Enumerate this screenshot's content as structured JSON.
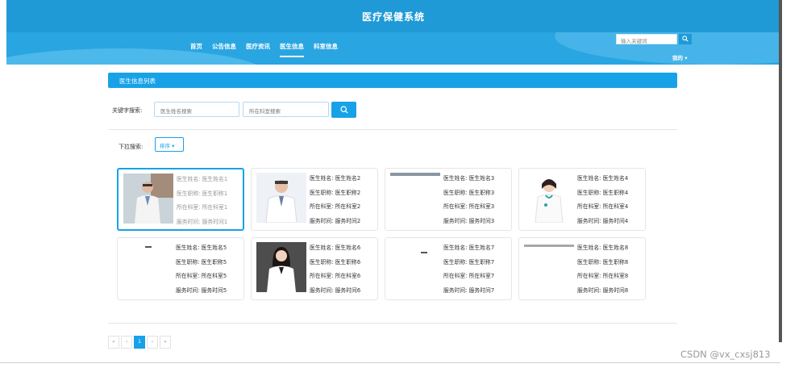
{
  "header": {
    "site_title": "医疗保健系统"
  },
  "nav": {
    "items": [
      {
        "label": "首页"
      },
      {
        "label": "公告信息"
      },
      {
        "label": "医疗资讯"
      },
      {
        "label": "医生信息"
      },
      {
        "label": "科室信息"
      }
    ],
    "active_index": 3,
    "search_placeholder": "输入关键词",
    "user_menu": "我的 ▾"
  },
  "section": {
    "title": "医生信息列表"
  },
  "filters": {
    "keyword_label": "关键字搜索:",
    "name_placeholder": "医生姓名搜索",
    "dept_placeholder": "所在科室搜索",
    "dropdown_label": "下拉搜索:",
    "sort_label": "排序 ▾"
  },
  "doctors": [
    {
      "name": "医生姓名: 医生姓名1",
      "title": "医生职称: 医生职称1",
      "dept": "所在科室: 所在科室1",
      "time": "服务时间: 服务时间1",
      "photo": "doctor-male-glasses"
    },
    {
      "name": "医生姓名: 医生姓名2",
      "title": "医生职称: 医生职称2",
      "dept": "所在科室: 所在科室2",
      "time": "服务时间: 服务时间2",
      "photo": "doctor-male-senior"
    },
    {
      "name": "医生姓名: 医生姓名3",
      "title": "医生职称: 医生职称3",
      "dept": "所在科室: 所在科室3",
      "time": "服务时间: 服务时间3",
      "photo": "photo-cropped"
    },
    {
      "name": "医生姓名: 医生姓名4",
      "title": "医生职称: 医生职称4",
      "dept": "所在科室: 所在科室4",
      "time": "服务时间: 服务时间4",
      "photo": "doctor-female-stethoscope"
    },
    {
      "name": "医生姓名: 医生姓名5",
      "title": "医生职称: 医生职称5",
      "dept": "所在科室: 所在科室5",
      "time": "服务时间: 服务时间5",
      "photo": "photo-cropped"
    },
    {
      "name": "医生姓名: 医生姓名6",
      "title": "医生职称: 医生职称6",
      "dept": "所在科室: 所在科室6",
      "time": "服务时间: 服务时间6",
      "photo": "doctor-female-dark"
    },
    {
      "name": "医生姓名: 医生姓名7",
      "title": "医生职称: 医生职称7",
      "dept": "所在科室: 所在科室7",
      "time": "服务时间: 服务时间7",
      "photo": "photo-cropped"
    },
    {
      "name": "医生姓名: 医生姓名8",
      "title": "医生职称: 医生职称8",
      "dept": "所在科室: 所在科室8",
      "time": "服务时间: 服务时间8",
      "photo": "photo-cropped"
    }
  ],
  "pagination": {
    "first": "«",
    "prev": "‹",
    "current": "1",
    "next": "›",
    "last": "»"
  },
  "watermark": "CSDN @vx_cxsj813",
  "colors": {
    "primary": "#17a2e8",
    "header_bg": "#1f9ad6"
  }
}
